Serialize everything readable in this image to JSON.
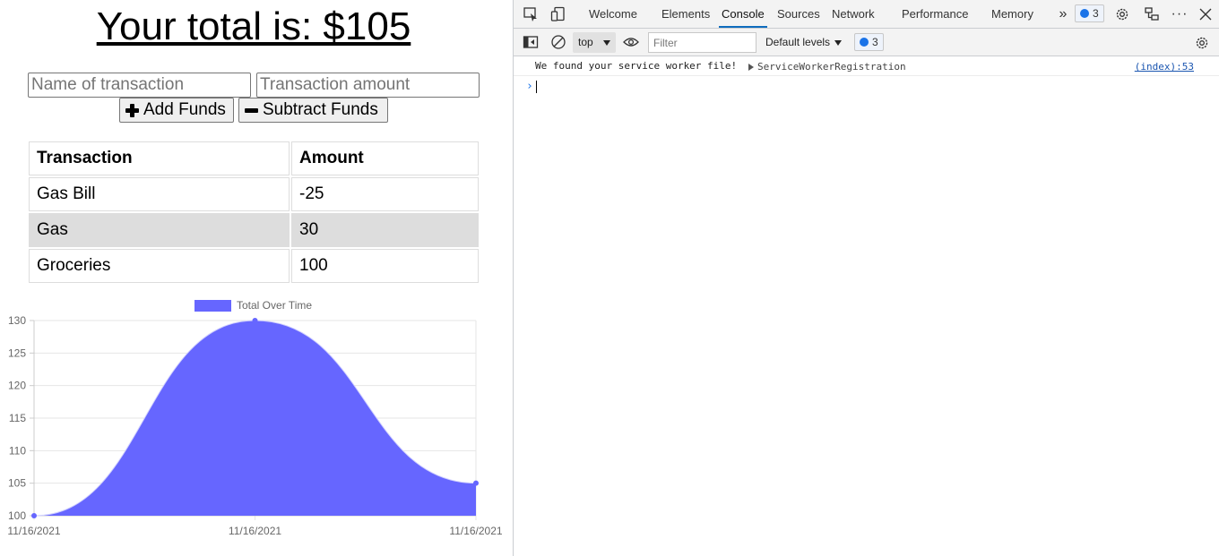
{
  "app": {
    "total_text": "Your total is: $105",
    "name_placeholder": "Name of transaction",
    "amount_placeholder": "Transaction amount",
    "add_label": "Add Funds",
    "subtract_label": "Subtract Funds",
    "table": {
      "headers": [
        "Transaction",
        "Amount"
      ],
      "rows": [
        {
          "name": "Gas Bill",
          "amount": "-25"
        },
        {
          "name": "Gas",
          "amount": "30"
        },
        {
          "name": "Groceries",
          "amount": "100"
        }
      ]
    }
  },
  "chart_data": {
    "type": "area",
    "categories": [
      "11/16/2021",
      "11/16/2021",
      "11/16/2021"
    ],
    "series": [
      {
        "name": "Total Over Time",
        "values": [
          100,
          130,
          105
        ],
        "color": "#6666ff"
      }
    ],
    "yticks": [
      100,
      105,
      110,
      115,
      120,
      125,
      130
    ],
    "ylim": [
      100,
      130
    ],
    "grid": true,
    "legend": "top-center"
  },
  "devtools": {
    "tabs": [
      "Welcome",
      "Elements",
      "Console",
      "Sources",
      "Network",
      "Performance",
      "Memory"
    ],
    "active_tab": "Console",
    "issues_count": "3",
    "context": "top",
    "filter_placeholder": "Filter",
    "levels": "Default levels",
    "toolbar_issues_count": "3",
    "console": {
      "message": "We found your service worker file!",
      "object": "ServiceWorkerRegistration",
      "source": "(index):53"
    },
    "accent": "#0f6cbd"
  }
}
